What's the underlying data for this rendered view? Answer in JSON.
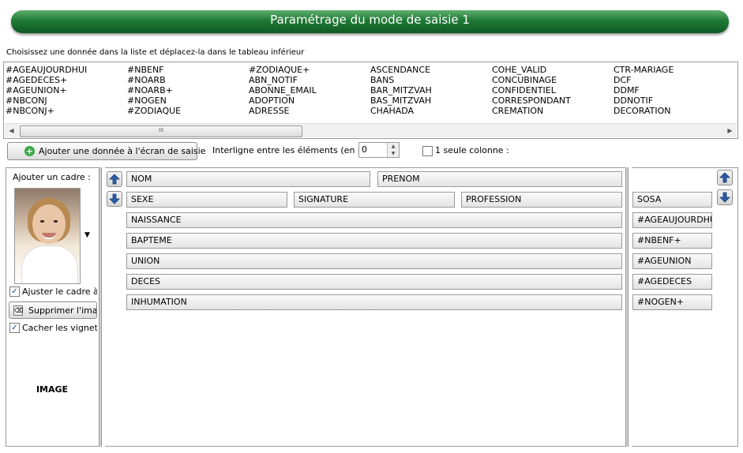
{
  "title": "Paramétrage du mode de saisie 1",
  "instruction": "Choisissez une donnée dans la liste et déplacez-la dans le tableau inférieur",
  "source_list": {
    "columns": [
      [
        "#AGEAUJOURDHUI",
        "#AGEDECES+",
        "#AGEUNION+",
        "#NBCONJ",
        "#NBCONJ+"
      ],
      [
        "#NBENF",
        "#NOARB",
        "#NOARB+",
        "#NOGEN",
        "#ZODIAQUE"
      ],
      [
        "#ZODIAQUE+",
        "ABN_NOTIF",
        "ABONNE_EMAIL",
        "ADOPTION",
        "ADRESSE"
      ],
      [
        "ASCENDANCE",
        "BANS",
        "BAR_MITZVAH",
        "BAS_MITZVAH",
        "CHAHADA"
      ],
      [
        "COHE_VALID",
        "CONCUBINAGE",
        "CONFIDENTIEL",
        "CORRESPONDANT",
        "CREMATION"
      ],
      [
        "CTR-MARIAGE",
        "DCF",
        "DDMF",
        "DDNOTIF",
        "DECORATION"
      ]
    ],
    "scroll_thumb_glyph": "III"
  },
  "toolbar": {
    "add_button_label": "Ajouter une donnée à l'écran de saisie",
    "spacing_label": "Interligne entre les éléments (en pixel) :",
    "spacing_value": "0",
    "single_column_label": "1 seule colonne :",
    "single_column_checked": false
  },
  "left_panel": {
    "frame_label": "Ajouter un cadre :",
    "adjust_label": "Ajuster le cadre à la",
    "adjust_checked": true,
    "delete_image_label": "Supprimer l'image",
    "hide_thumbnails_label": "Cacher les vignettes",
    "hide_thumbnails_checked": true,
    "image_caption": "IMAGE"
  },
  "form_rows": [
    [
      "NOM",
      "PRENOM"
    ],
    [
      "SEXE",
      "SIGNATURE",
      "PROFESSION"
    ],
    [
      "NAISSANCE"
    ],
    [
      "BAPTEME"
    ],
    [
      "UNION"
    ],
    [
      "DECES"
    ],
    [
      "INHUMATION"
    ]
  ],
  "right_list": [
    "SOSA",
    "#AGEAUJOURDHUI",
    "#NBENF+",
    "#AGEUNION",
    "#AGEDECES",
    "#NOGEN+"
  ],
  "colors": {
    "banner_green": "#1f7a36",
    "arrow_blue": "#2a5da8"
  }
}
